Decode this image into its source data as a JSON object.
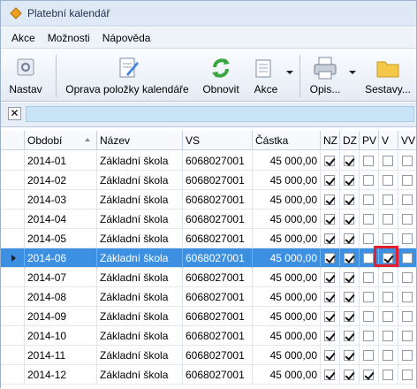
{
  "window": {
    "title": "Platební kalendář"
  },
  "menu": [
    "Akce",
    "Možnosti",
    "Nápověda"
  ],
  "toolbar": {
    "nastav": "Nastav",
    "oprava": "Oprava položky kalendáře",
    "obnovit": "Obnovit",
    "akce": "Akce",
    "opis": "Opis...",
    "sestavy": "Sestavy..."
  },
  "filter": {
    "clear": "✕"
  },
  "columns": {
    "obdobi": "Období",
    "nazev": "Název",
    "vs": "VS",
    "castka": "Částka",
    "nz": "NZ",
    "dz": "DZ",
    "pv": "PV",
    "v": "V",
    "vv": "VV"
  },
  "rows": [
    {
      "obdobi": "2014-01",
      "nazev": "Základní škola",
      "vs": "6068027001",
      "castka": "45 000,00",
      "nz": true,
      "dz": true,
      "pv": false,
      "v": false,
      "vv": false
    },
    {
      "obdobi": "2014-02",
      "nazev": "Základní škola",
      "vs": "6068027001",
      "castka": "45 000,00",
      "nz": true,
      "dz": true,
      "pv": false,
      "v": false,
      "vv": false
    },
    {
      "obdobi": "2014-03",
      "nazev": "Základní škola",
      "vs": "6068027001",
      "castka": "45 000,00",
      "nz": true,
      "dz": true,
      "pv": false,
      "v": false,
      "vv": false
    },
    {
      "obdobi": "2014-04",
      "nazev": "Základní škola",
      "vs": "6068027001",
      "castka": "45 000,00",
      "nz": true,
      "dz": true,
      "pv": false,
      "v": false,
      "vv": false
    },
    {
      "obdobi": "2014-05",
      "nazev": "Základní škola",
      "vs": "6068027001",
      "castka": "45 000,00",
      "nz": true,
      "dz": true,
      "pv": false,
      "v": false,
      "vv": false
    },
    {
      "obdobi": "2014-06",
      "nazev": "Základní škola",
      "vs": "6068027001",
      "castka": "45 000,00",
      "nz": true,
      "dz": true,
      "pv": false,
      "v": true,
      "vv": false,
      "selected": true
    },
    {
      "obdobi": "2014-07",
      "nazev": "Základní škola",
      "vs": "6068027001",
      "castka": "45 000,00",
      "nz": true,
      "dz": true,
      "pv": false,
      "v": false,
      "vv": false
    },
    {
      "obdobi": "2014-08",
      "nazev": "Základní škola",
      "vs": "6068027001",
      "castka": "45 000,00",
      "nz": true,
      "dz": true,
      "pv": false,
      "v": false,
      "vv": false
    },
    {
      "obdobi": "2014-09",
      "nazev": "Základní škola",
      "vs": "6068027001",
      "castka": "45 000,00",
      "nz": true,
      "dz": true,
      "pv": false,
      "v": false,
      "vv": false
    },
    {
      "obdobi": "2014-10",
      "nazev": "Základní škola",
      "vs": "6068027001",
      "castka": "45 000,00",
      "nz": true,
      "dz": true,
      "pv": false,
      "v": false,
      "vv": false
    },
    {
      "obdobi": "2014-11",
      "nazev": "Základní škola",
      "vs": "6068027001",
      "castka": "45 000,00",
      "nz": true,
      "dz": true,
      "pv": false,
      "v": false,
      "vv": false
    },
    {
      "obdobi": "2014-12",
      "nazev": "Základní škola",
      "vs": "6068027001",
      "castka": "45 000,00",
      "nz": true,
      "dz": true,
      "pv": true,
      "v": false,
      "vv": false
    }
  ],
  "colors": {
    "selection": "#3d90e1",
    "highlight": "#e0202e"
  }
}
